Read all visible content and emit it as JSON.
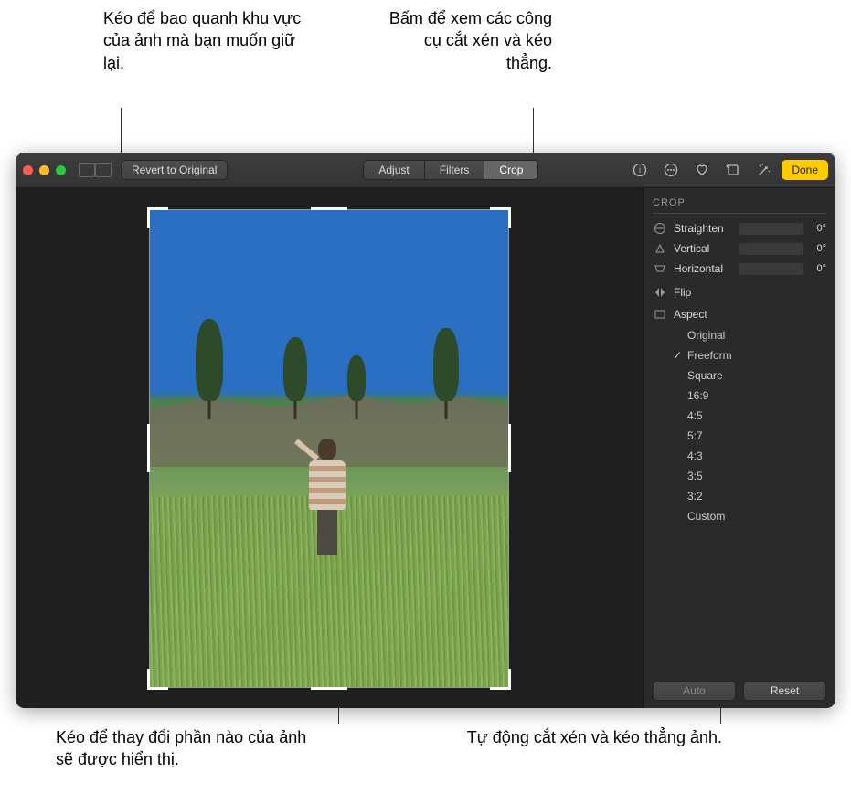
{
  "callouts": {
    "top_left": "Kéo để bao quanh khu vực của ảnh mà bạn muốn giữ lại.",
    "top_right": "Bấm để xem các công cụ cắt xén và kéo thẳng.",
    "bottom_left": "Kéo để thay đổi phần nào của ảnh sẽ được hiển thị.",
    "bottom_right": "Tự động cắt xén và kéo thẳng ảnh."
  },
  "toolbar": {
    "revert": "Revert to Original",
    "tabs": {
      "adjust": "Adjust",
      "filters": "Filters",
      "crop": "Crop",
      "active": "Crop"
    },
    "done": "Done"
  },
  "inspector": {
    "title": "CROP",
    "sliders": {
      "straighten": {
        "label": "Straighten",
        "value": "0°"
      },
      "vertical": {
        "label": "Vertical",
        "value": "0°"
      },
      "horizontal": {
        "label": "Horizontal",
        "value": "0°"
      }
    },
    "flip": "Flip",
    "aspect_label": "Aspect",
    "aspect": {
      "items": [
        "Original",
        "Freeform",
        "Square",
        "16:9",
        "4:5",
        "5:7",
        "4:3",
        "3:5",
        "3:2",
        "Custom"
      ],
      "selected": "Freeform"
    },
    "auto": "Auto",
    "reset": "Reset"
  }
}
